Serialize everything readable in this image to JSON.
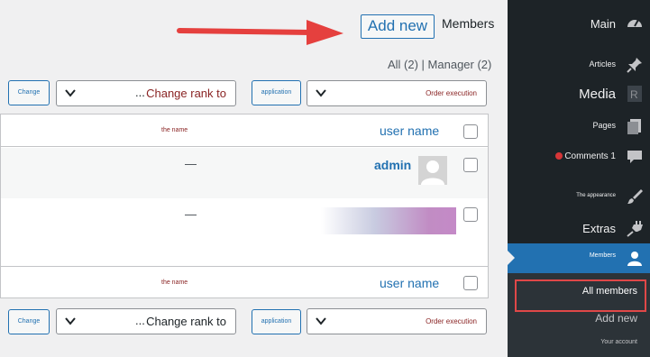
{
  "header": {
    "add_new_label": "Add new",
    "title": "Members"
  },
  "filters": {
    "text": "All (2) | Manager (2)"
  },
  "bulk_top": {
    "change_button": "Change",
    "rank_dots": "...",
    "rank_select": "Change rank to",
    "apply_button": "application",
    "action_select": "Order execution"
  },
  "bulk_bottom": {
    "change_button": "Change",
    "rank_dots": "...",
    "rank_select": "Change rank to",
    "apply_button": "application",
    "action_select": "Order execution"
  },
  "table": {
    "columns": {
      "name": "the name",
      "username": "user name"
    },
    "rows": [
      {
        "name": "—",
        "username": "admin"
      },
      {
        "name": "—",
        "username": ""
      }
    ]
  },
  "sidebar": {
    "items": [
      {
        "label": "Main",
        "icon": "dashboard-icon"
      },
      {
        "label": "Articles",
        "icon": "pin-icon"
      },
      {
        "label": "Media",
        "icon": "media-icon"
      },
      {
        "label": "Pages",
        "icon": "pages-icon"
      },
      {
        "label": "Comments 1",
        "icon": "comment-icon"
      },
      {
        "label": "The appearance",
        "icon": "brush-icon"
      },
      {
        "label": "Extras",
        "icon": "plugin-icon"
      },
      {
        "label": "Members",
        "icon": "user-icon"
      }
    ],
    "submenu": [
      "All members",
      "Add new",
      "Your account"
    ]
  },
  "colors": {
    "accent": "#2271b1",
    "sidebar_bg": "#1d2327",
    "highlight": "#e04848",
    "arrow": "#e5403e"
  }
}
